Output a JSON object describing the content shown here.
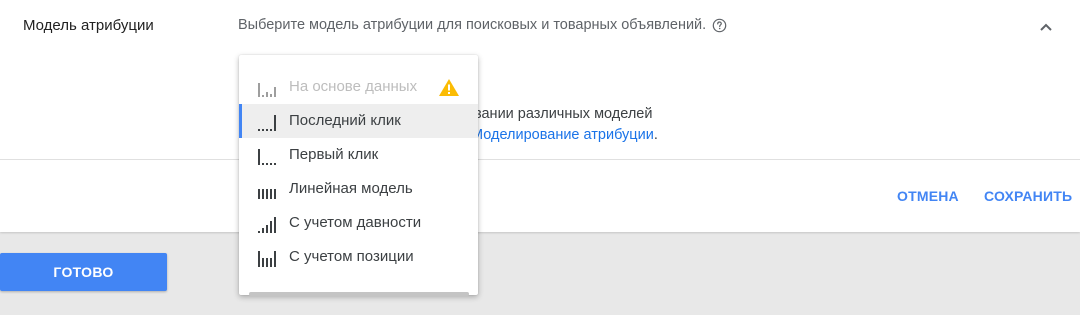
{
  "attribution": {
    "label": "Модель атрибуции",
    "hint": "Выберите модель атрибуции для поисковых и товарных объявлений.",
    "description_text": "ия в учете конверсий при использовании различных моделей",
    "description_link": "Моделирование атрибуции",
    "description_end": "."
  },
  "dropdown": {
    "items": [
      {
        "label": "На основе данных",
        "icon": "data-driven-icon",
        "disabled": true,
        "warning": true
      },
      {
        "label": "Последний клик",
        "icon": "last-click-icon",
        "selected": true
      },
      {
        "label": "Первый клик",
        "icon": "first-click-icon"
      },
      {
        "label": "Линейная модель",
        "icon": "linear-icon"
      },
      {
        "label": "С учетом давности",
        "icon": "time-decay-icon"
      },
      {
        "label": "С учетом позиции",
        "icon": "position-based-icon"
      }
    ]
  },
  "actions": {
    "cancel": "ОТМЕНА",
    "save": "СОХРАНИТЬ",
    "done": "ГОТОВО"
  },
  "colors": {
    "accent": "#4285f4",
    "warning": "#fbbc04",
    "link": "#1a73e8"
  }
}
